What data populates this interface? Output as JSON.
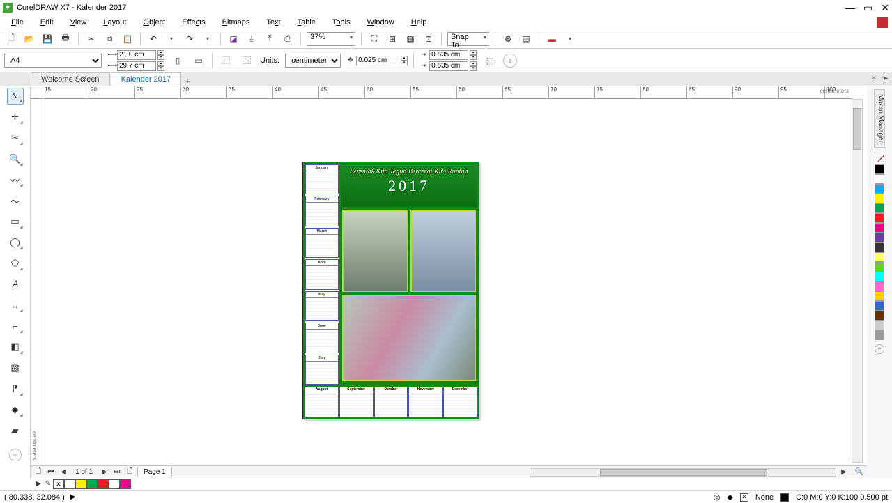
{
  "app": {
    "title": "CorelDRAW X7 - Kalender 2017"
  },
  "menu": [
    "File",
    "Edit",
    "View",
    "Layout",
    "Object",
    "Effects",
    "Bitmaps",
    "Text",
    "Table",
    "Tools",
    "Window",
    "Help"
  ],
  "toolbar": {
    "zoom": "37%",
    "snap": "Snap To"
  },
  "propbar": {
    "page_size": "A4",
    "width": "21.0 cm",
    "height": "29.7 cm",
    "units_label": "Units:",
    "units": "centimeters",
    "nudge": "0.025 cm",
    "dup_x": "0.635 cm",
    "dup_y": "0.635 cm"
  },
  "tabs": {
    "items": [
      "Welcome Screen",
      "Kalender 2017"
    ],
    "active": 1
  },
  "ruler": {
    "unit": "centimeters",
    "h_ticks": [
      "15",
      "20",
      "25",
      "30",
      "35",
      "40",
      "45",
      "50",
      "55",
      "60",
      "65",
      "70",
      "75",
      "80",
      "85",
      "90",
      "95",
      "100"
    ]
  },
  "sidepanel": {
    "macro": "Macro Manager"
  },
  "palette_right": [
    "#000000",
    "#FFFFFF",
    "#00AEEF",
    "#FFF200",
    "#00A651",
    "#ED1C24",
    "#EC008C",
    "#6A3D9A",
    "#333333",
    "#FFFF66",
    "#66CC33",
    "#00FFFF",
    "#FF66CC",
    "#FFCC00",
    "#3366CC",
    "#663300",
    "#CCCCCC",
    "#999999"
  ],
  "palette_doc": [
    "#FFFFFF",
    "#FFF200",
    "#00A651",
    "#ED1C24",
    "#FFFFFF",
    "#EC008C"
  ],
  "art": {
    "year": "2017",
    "tagline": "Serentak Kita Teguh Bercerai Kita Runtuh",
    "left_months": [
      "January",
      "February",
      "March",
      "April",
      "May",
      "June",
      "July"
    ],
    "bottom_months": [
      "August",
      "September",
      "October",
      "November",
      "December"
    ]
  },
  "pagetabs": {
    "count": "1 of 1",
    "page": "Page 1"
  },
  "status": {
    "coords": "( 80.338, 32.084 )",
    "fill": "None",
    "color": "C:0 M:0 Y:0 K:100 0.500 pt"
  }
}
